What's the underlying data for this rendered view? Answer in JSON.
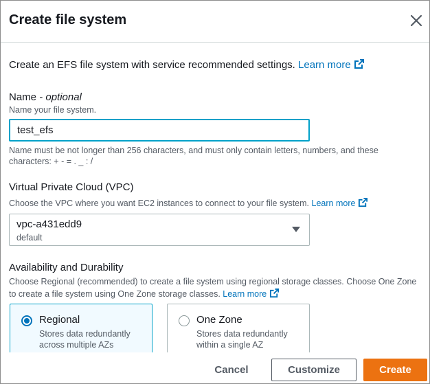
{
  "dialog": {
    "title": "Create file system"
  },
  "intro": {
    "text": "Create an EFS file system with service recommended settings.",
    "link": "Learn more"
  },
  "name_field": {
    "label": "Name",
    "label_suffix": " - optional",
    "description": "Name your file system.",
    "value": "test_efs",
    "constraint": "Name must be not longer than 256 characters, and must only contain letters, numbers, and these characters: + - = . _ : /"
  },
  "vpc_field": {
    "label": "Virtual Private Cloud (VPC)",
    "description": "Choose the VPC where you want EC2 instances to connect to your file system.",
    "link": "Learn more",
    "selected_value": "vpc-a431edd9",
    "selected_sub": "default"
  },
  "availability": {
    "label": "Availability and Durability",
    "description": "Choose Regional (recommended) to create a file system using regional storage classes. Choose One Zone to create a file system using One Zone storage classes.",
    "link": "Learn more",
    "options": [
      {
        "title": "Regional",
        "description": "Stores data redundantly across multiple AZs",
        "selected": true
      },
      {
        "title": "One Zone",
        "description": "Stores data redundantly within a single AZ",
        "selected": false
      }
    ]
  },
  "footer": {
    "cancel_label": "Cancel",
    "customize_label": "Customize",
    "create_label": "Create"
  },
  "colors": {
    "link": "#0073bb",
    "primary_button": "#ec7211",
    "focus_border": "#00a1c9",
    "selected_tile_bg": "#f1faff"
  },
  "icons": {
    "close": "close-icon",
    "external": "external-link-icon",
    "caret": "caret-down-icon"
  }
}
